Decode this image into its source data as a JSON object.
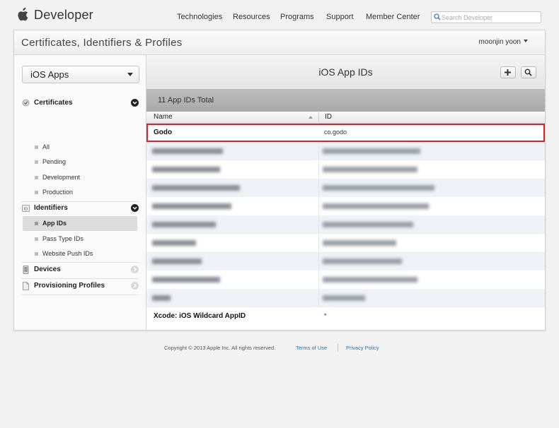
{
  "brand": "Developer",
  "nav": [
    "Technologies",
    "Resources",
    "Programs",
    "Support",
    "Member Center"
  ],
  "search": {
    "placeholder": "Search Developer"
  },
  "panel": {
    "title": "Certificates, Identifiers & Profiles",
    "user": "moonjin yoon"
  },
  "sidebar": {
    "platform": "iOS Apps",
    "sections": [
      {
        "label": "Certificates",
        "expanded": true,
        "items": [
          "All",
          "Pending",
          "Development",
          "Production"
        ]
      },
      {
        "label": "Identifiers",
        "expanded": true,
        "items": [
          "App IDs",
          "Pass Type IDs",
          "Website Push IDs"
        ],
        "active_item": "App IDs"
      },
      {
        "label": "Devices",
        "expanded": false
      },
      {
        "label": "Provisioning Profiles",
        "expanded": false
      }
    ]
  },
  "content": {
    "title": "iOS App IDs",
    "total": "11 App IDs Total",
    "columns": {
      "name": "Name",
      "id": "ID"
    },
    "rows": [
      {
        "name": "Godo",
        "id": "co.godo",
        "selected": true
      },
      {
        "name": "",
        "id": "",
        "blurred": true
      },
      {
        "name": "",
        "id": "",
        "blurred": true
      },
      {
        "name": "",
        "id": "",
        "blurred": true
      },
      {
        "name": "",
        "id": "",
        "blurred": true
      },
      {
        "name": "",
        "id": "",
        "blurred": true
      },
      {
        "name": "",
        "id": "",
        "blurred": true
      },
      {
        "name": "",
        "id": "",
        "blurred": true
      },
      {
        "name": "",
        "id": "",
        "blurred": true
      },
      {
        "name": "",
        "id": "",
        "blurred": true
      },
      {
        "name": "Xcode: iOS Wildcard AppID",
        "id": "*"
      }
    ]
  },
  "footer": {
    "copyright": "Copyright © 2013 Apple Inc. All rights reserved.",
    "terms": "Terms of Use",
    "privacy": "Privacy Policy"
  },
  "colors": {
    "selection_outline": "#e01e26",
    "link": "#2a6fb5",
    "row_stripe": "#eef1f5"
  },
  "icons": [
    "apple-logo",
    "search-icon",
    "caret-down-icon",
    "certificate-icon",
    "id-badge-icon",
    "device-icon",
    "document-icon",
    "chevron-down-icon",
    "chevron-right-icon",
    "plus-icon"
  ]
}
